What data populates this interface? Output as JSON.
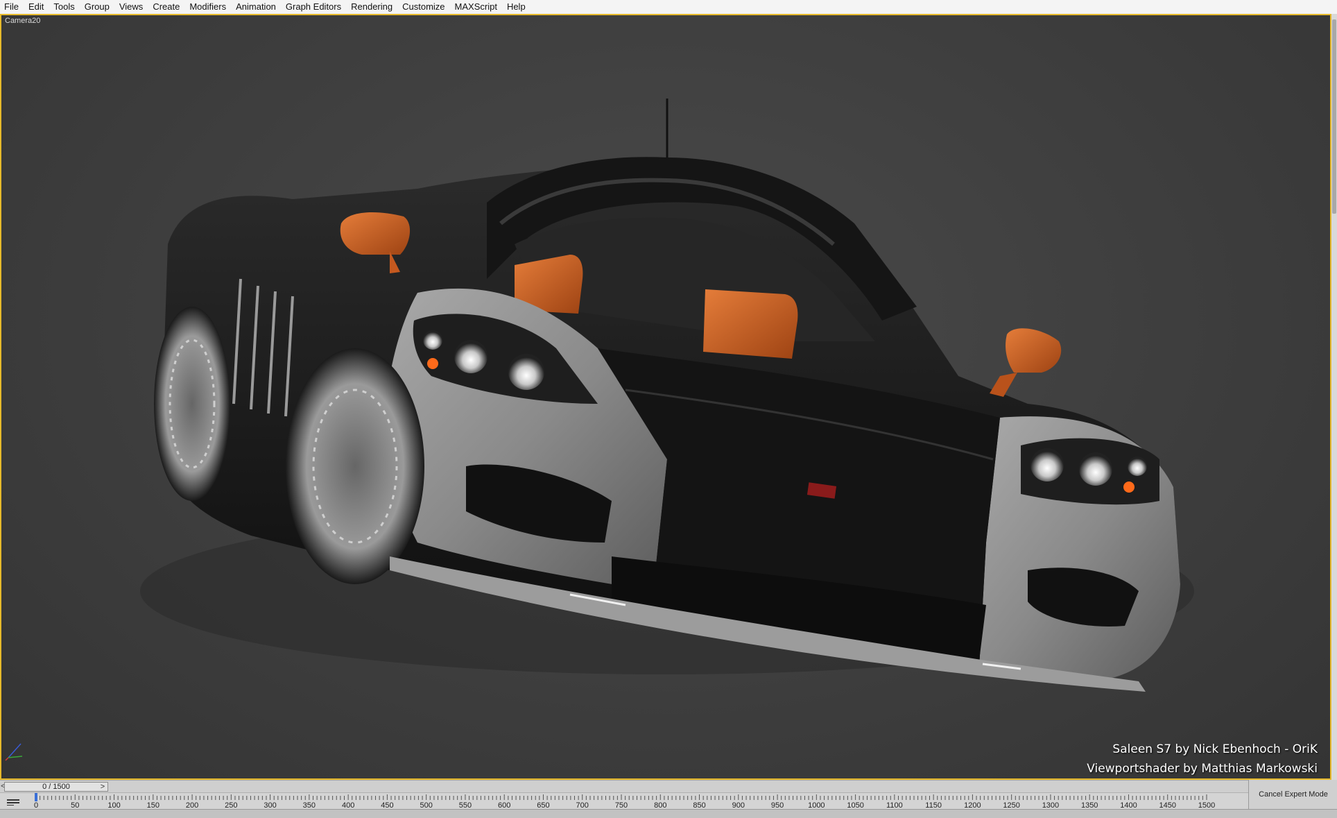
{
  "menu": [
    "File",
    "Edit",
    "Tools",
    "Group",
    "Views",
    "Create",
    "Modifiers",
    "Animation",
    "Graph Editors",
    "Rendering",
    "Customize",
    "MAXScript",
    "Help"
  ],
  "viewport": {
    "label": "Camera20",
    "credits_line1": "Saleen S7 by Nick Ebenhoch - OriK",
    "credits_line2": "Viewportshader by Matthias Markowski",
    "border_color": "#e6b92a",
    "accent_orange": "#d2622a"
  },
  "timeslider": {
    "frame_display": "0 / 1500",
    "prev_glyph": "<",
    "next_glyph": ">"
  },
  "trackbar": {
    "ticks": [
      "0",
      "50",
      "100",
      "150",
      "200",
      "250",
      "300",
      "350",
      "400",
      "450",
      "500",
      "550",
      "600",
      "650",
      "700",
      "750",
      "800",
      "850",
      "900",
      "950",
      "1000",
      "1050",
      "1100",
      "1150",
      "1200",
      "1250",
      "1300",
      "1350",
      "1400",
      "1450",
      "1500"
    ]
  },
  "cancel_expert_label": "Cancel Expert Mode"
}
